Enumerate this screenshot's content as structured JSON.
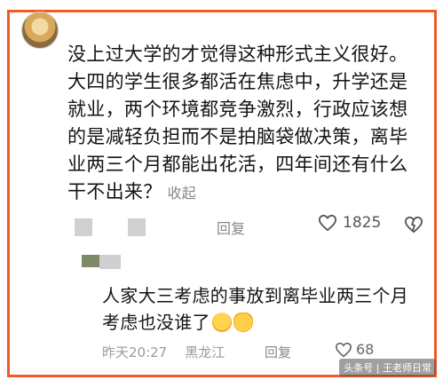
{
  "comment": {
    "text": "没上过大学的才觉得这种形式主义很好。大四的学生很多都活在焦虑中，升学还是就业，两个环境都竞争激烈，行政应该想的是减轻负担而不是拍脑袋做决策，离毕业两三个月都能出花活，四年间还有什么干不出来？",
    "collapse_label": "收起",
    "reply_label": "回复",
    "like_count": "1825"
  },
  "reply": {
    "text": "人家大三考虑的事放到离毕业两三个月考虑也没谁了",
    "time": "昨天20:27",
    "location": "黑龙江",
    "reply_label": "回复",
    "like_count": "68"
  },
  "watermark": {
    "text": "头条号 | 王老师日常"
  },
  "colors": {
    "frame": "#f05a28"
  }
}
